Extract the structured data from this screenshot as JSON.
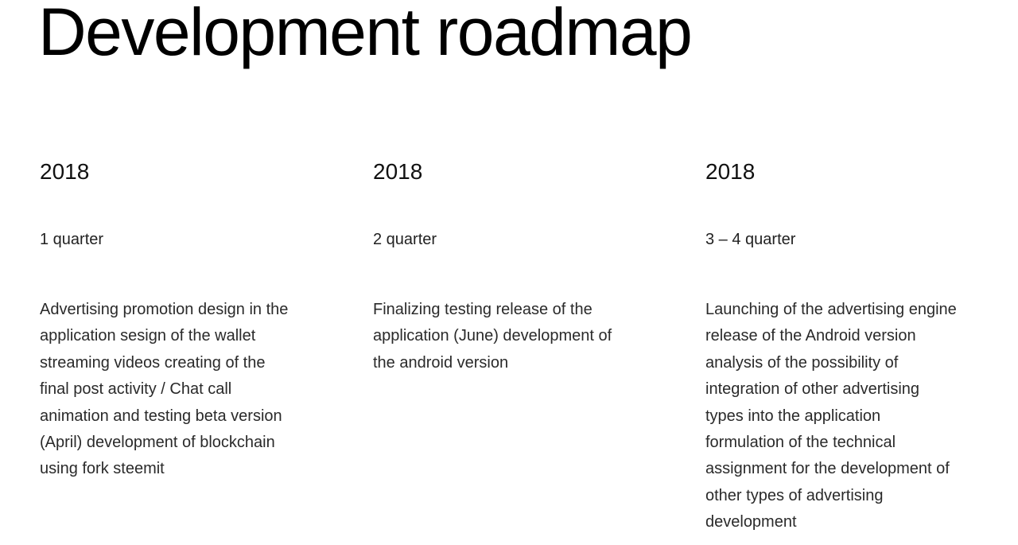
{
  "header": {
    "title": "Development roadmap"
  },
  "colors": {
    "background": "#ffffff",
    "title": "#000000",
    "text": "#2a2a2a"
  },
  "roadmap": [
    {
      "year": "2018",
      "period": "1 quarter",
      "lines": [
        "Advertising promotion design in the",
        "application sesign of the wallet",
        "streaming videos creating of the",
        "final post activity / Chat call",
        "animation and testing beta version",
        "(April) development of blockchain",
        "using fork steemit"
      ]
    },
    {
      "year": "2018",
      "period": "2 quarter",
      "lines": [
        "Finalizing testing release of the",
        "application (June) development of",
        "the android version"
      ]
    },
    {
      "year": "2018",
      "period": "3 – 4 quarter",
      "lines": [
        "Launching of the advertising engine",
        "release of the Android version",
        "analysis of the possibility of",
        "integration of other advertising",
        "types into the application",
        "formulation of the technical",
        "assignment for the development of",
        "other types of advertising",
        "development"
      ]
    }
  ]
}
